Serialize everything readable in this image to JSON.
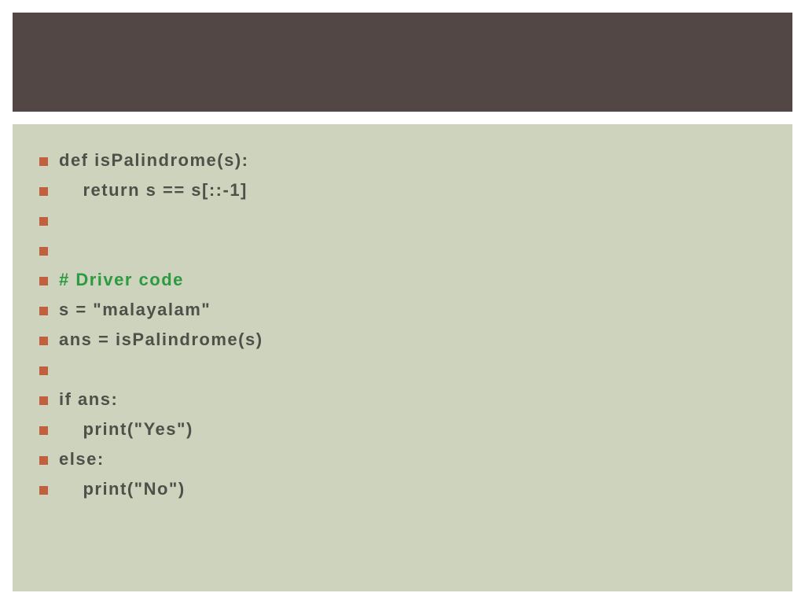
{
  "colors": {
    "header_bg": "#524744",
    "content_bg": "#ced3bd",
    "bullet": "#c15f3e",
    "text": "#4f5049",
    "comment": "#2a9b3f"
  },
  "lines": [
    {
      "text": "def isPalindrome(s):",
      "style": "normal"
    },
    {
      "text": "    return s == s[::-1]",
      "style": "normal"
    },
    {
      "text": "",
      "style": "normal"
    },
    {
      "text": "",
      "style": "normal"
    },
    {
      "text": "# Driver code",
      "style": "comment"
    },
    {
      "text": "s = \"malayalam\"",
      "style": "normal"
    },
    {
      "text": "ans = isPalindrome(s)",
      "style": "normal"
    },
    {
      "text": "",
      "style": "normal"
    },
    {
      "text": "if ans:",
      "style": "normal"
    },
    {
      "text": "    print(\"Yes\")",
      "style": "normal"
    },
    {
      "text": "else:",
      "style": "normal"
    },
    {
      "text": "    print(\"No\")",
      "style": "normal"
    }
  ]
}
